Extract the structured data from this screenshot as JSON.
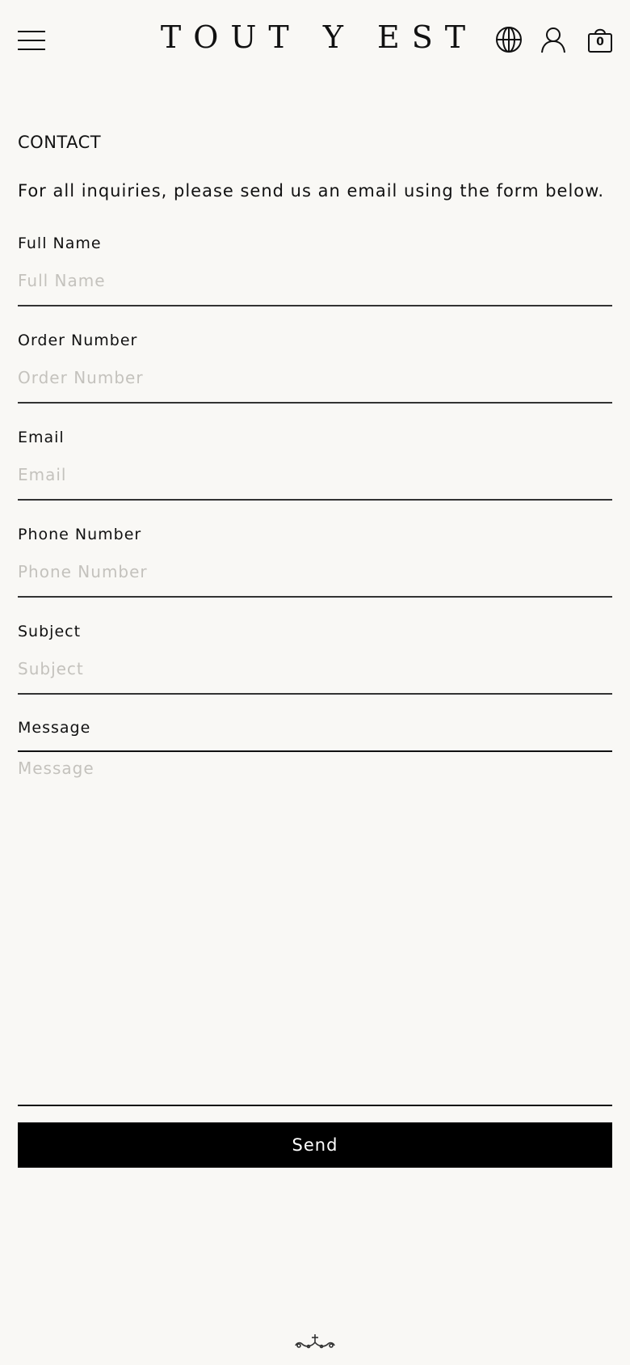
{
  "header": {
    "logo": "TOUT Y EST",
    "cart_count": "0",
    "icons": {
      "menu": "hamburger-menu-icon",
      "language": "globe-icon",
      "account": "user-icon",
      "cart": "shopping-bag-icon"
    }
  },
  "contact": {
    "title": "CONTACT",
    "intro": "For all inquiries, please send us an email using the form below."
  },
  "form": {
    "full_name": {
      "label": "Full Name",
      "placeholder": "Full Name"
    },
    "order_number": {
      "label": "Order Number",
      "placeholder": "Order Number"
    },
    "email": {
      "label": "Email",
      "placeholder": "Email"
    },
    "phone_number": {
      "label": "Phone Number",
      "placeholder": "Phone Number"
    },
    "subject": {
      "label": "Subject",
      "placeholder": "Subject"
    },
    "message": {
      "label": "Message",
      "placeholder": "Message"
    },
    "send_label": "Send"
  },
  "footer": {
    "ornament_icon": "fleuron-ornament-icon"
  },
  "colors": {
    "background": "#f9f8f5",
    "text": "#111111",
    "placeholder": "#c4c2bd",
    "button": "#000000",
    "button_text": "#ffffff"
  }
}
